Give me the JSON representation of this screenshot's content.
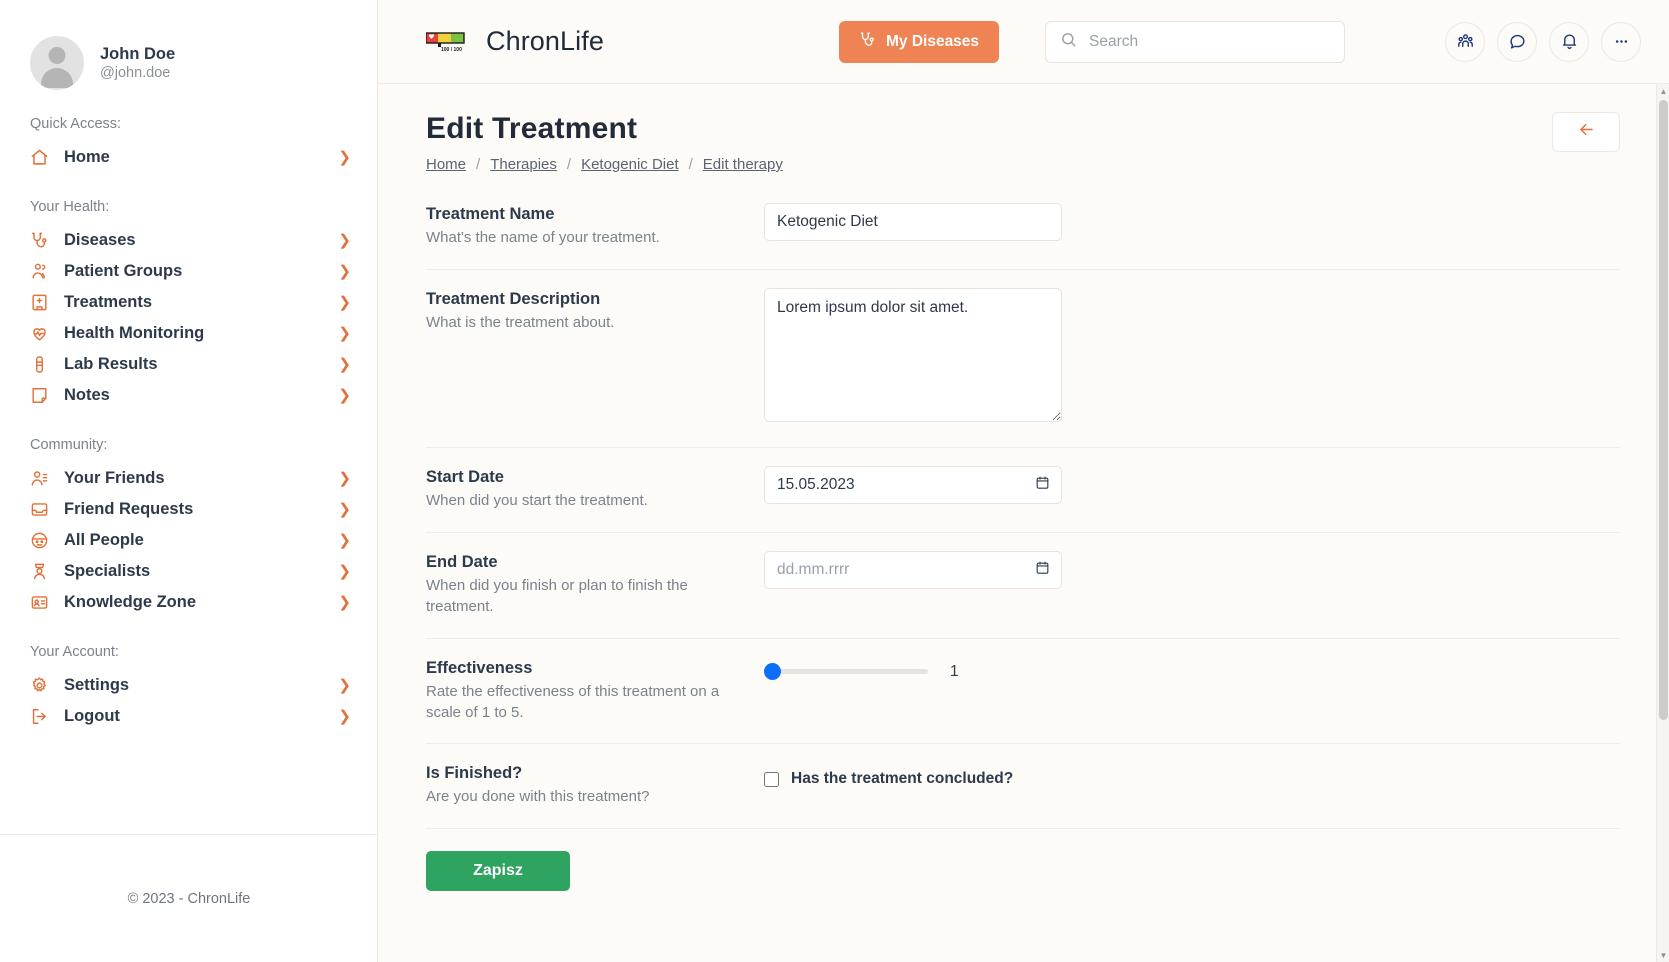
{
  "sidebar": {
    "profile": {
      "name": "John Doe",
      "handle": "@john.doe"
    },
    "sections": [
      {
        "heading": "Quick Access:",
        "items": [
          {
            "label": "Home",
            "icon": "home-icon"
          }
        ]
      },
      {
        "heading": "Your Health:",
        "items": [
          {
            "label": "Diseases",
            "icon": "stethoscope-icon"
          },
          {
            "label": "Patient Groups",
            "icon": "users-group-icon"
          },
          {
            "label": "Treatments",
            "icon": "hospital-icon"
          },
          {
            "label": "Health Monitoring",
            "icon": "heart-pulse-icon"
          },
          {
            "label": "Lab Results",
            "icon": "test-tube-icon"
          },
          {
            "label": "Notes",
            "icon": "note-icon"
          }
        ]
      },
      {
        "heading": "Community:",
        "items": [
          {
            "label": "Your Friends",
            "icon": "user-list-icon"
          },
          {
            "label": "Friend Requests",
            "icon": "inbox-icon"
          },
          {
            "label": "All People",
            "icon": "globe-face-icon"
          },
          {
            "label": "Specialists",
            "icon": "doctor-icon"
          },
          {
            "label": "Knowledge Zone",
            "icon": "id-card-icon"
          }
        ]
      },
      {
        "heading": "Your Account:",
        "items": [
          {
            "label": "Settings",
            "icon": "gear-icon"
          },
          {
            "label": "Logout",
            "icon": "logout-icon"
          }
        ]
      }
    ],
    "footer": "© 2023 - ChronLife"
  },
  "topbar": {
    "brand": "ChronLife",
    "logo": {
      "icon": "health-bar-logo",
      "counter": "100 / 100"
    },
    "my_diseases_label": "My Diseases",
    "search_placeholder": "Search",
    "search_value": "",
    "icons": [
      {
        "name": "people-icon"
      },
      {
        "name": "chat-icon"
      },
      {
        "name": "bell-icon"
      },
      {
        "name": "more-icon"
      }
    ]
  },
  "page": {
    "title": "Edit Treatment",
    "breadcrumb": [
      "Home",
      "Therapies",
      "Ketogenic Diet",
      "Edit therapy"
    ],
    "breadcrumb_separator": "/",
    "back_icon": "arrow-left-icon"
  },
  "form": {
    "fields": [
      {
        "label": "Treatment Name",
        "help": "What's the name of your treatment.",
        "type": "text",
        "value": "Ketogenic Diet",
        "placeholder": ""
      },
      {
        "label": "Treatment Description",
        "help": "What is the treatment about.",
        "type": "textarea",
        "value": "Lorem ipsum dolor sit amet.",
        "placeholder": ""
      },
      {
        "label": "Start Date",
        "help": "When did you start the treatment.",
        "type": "date",
        "value": "15.05.2023",
        "placeholder": "dd.mm.rrrr"
      },
      {
        "label": "End Date",
        "help": "When did you finish or plan to finish the treatment.",
        "type": "date",
        "value": "",
        "placeholder": "dd.mm.rrrr"
      },
      {
        "label": "Effectiveness",
        "help": "Rate the effectiveness of this treatment on a scale of 1 to 5.",
        "type": "range",
        "value": "1",
        "min": "1",
        "max": "5"
      },
      {
        "label": "Is Finished?",
        "help": "Are you done with this treatment?",
        "type": "checkbox",
        "checkbox_label": "Has the treatment concluded?",
        "checked": false
      }
    ],
    "submit_label": "Zapisz"
  },
  "colors": {
    "accent_orange": "#ef8354",
    "icon_orange": "#e2703a",
    "save_green": "#2fa360",
    "slider_blue": "#0d6efd",
    "text_dark": "#2d3a4b",
    "page_bg": "#fdfbf7"
  }
}
